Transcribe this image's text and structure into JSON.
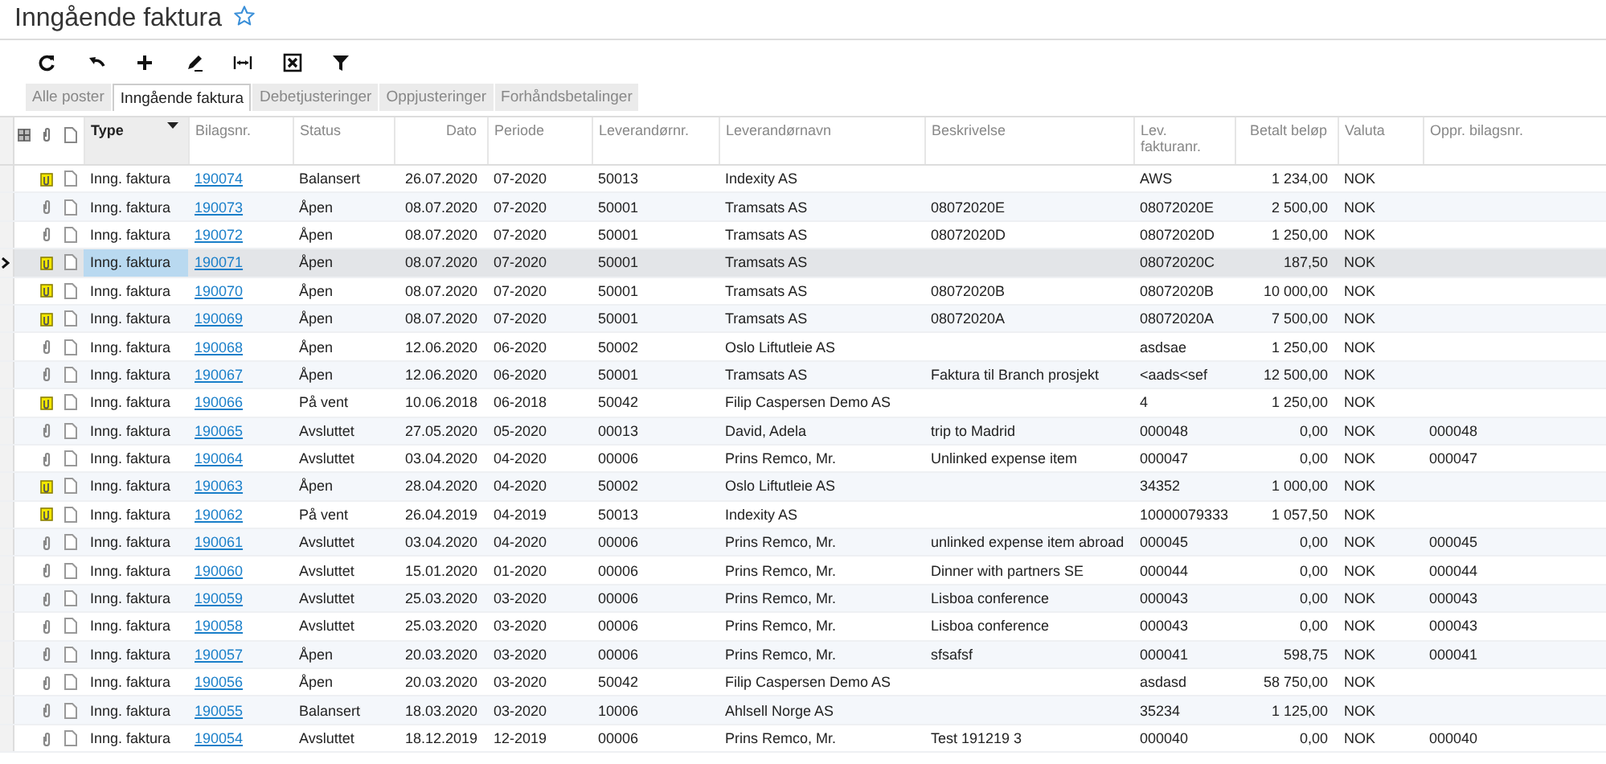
{
  "page": {
    "title": "Inngående faktura",
    "favorite": false
  },
  "toolbar": [
    {
      "kind": "refresh"
    },
    {
      "kind": "undo"
    },
    {
      "kind": "add"
    },
    {
      "kind": "edit"
    },
    {
      "kind": "fit"
    },
    {
      "kind": "excel"
    },
    {
      "kind": "filter"
    }
  ],
  "tabs": [
    {
      "label": "Alle poster",
      "selected": false
    },
    {
      "label": "Inngående faktura",
      "selected": true
    },
    {
      "label": "Debetjusteringer",
      "selected": false
    },
    {
      "label": "Oppjusteringer",
      "selected": false
    },
    {
      "label": "Forhåndsbetalinger",
      "selected": false
    }
  ],
  "table": {
    "columns": [
      {
        "label": "Type",
        "kind": "text",
        "sorted": true
      },
      {
        "label": "Bilagsnr.",
        "kind": "link",
        "sorted": false
      },
      {
        "label": "Status",
        "kind": "text",
        "sorted": false
      },
      {
        "label": "Dato",
        "kind": "number",
        "sorted": false
      },
      {
        "label": "Periode",
        "kind": "text",
        "sorted": false
      },
      {
        "label": "Leverandørnr.",
        "kind": "text",
        "sorted": false
      },
      {
        "label": "Leverandørnavn",
        "kind": "text",
        "sorted": false
      },
      {
        "label": "Beskrivelse",
        "kind": "text",
        "sorted": false
      },
      {
        "label": "Lev. fakturanr.",
        "kind": "text",
        "sorted": false
      },
      {
        "label": "Betalt beløp",
        "kind": "number",
        "sorted": false
      },
      {
        "label": "Valuta",
        "kind": "text",
        "sorted": false
      },
      {
        "label": "Oppr. bilagsnr.",
        "kind": "text",
        "sorted": false
      }
    ],
    "rows": [
      {
        "has_note": true,
        "selected": false,
        "cells": [
          "Inng. faktura",
          "190074",
          "Balansert",
          "26.07.2020",
          "07-2020",
          "50013",
          "Indexity AS",
          null,
          "AWS",
          "1 234,00",
          "NOK",
          null
        ]
      },
      {
        "has_note": false,
        "selected": false,
        "cells": [
          "Inng. faktura",
          "190073",
          "Åpen",
          "08.07.2020",
          "07-2020",
          "50001",
          "Tramsats AS",
          "08072020E",
          "08072020E",
          "2 500,00",
          "NOK",
          null
        ]
      },
      {
        "has_note": false,
        "selected": false,
        "cells": [
          "Inng. faktura",
          "190072",
          "Åpen",
          "08.07.2020",
          "07-2020",
          "50001",
          "Tramsats AS",
          "08072020D",
          "08072020D",
          "1 250,00",
          "NOK",
          null
        ]
      },
      {
        "has_note": true,
        "selected": true,
        "cells": [
          "Inng. faktura",
          "190071",
          "Åpen",
          "08.07.2020",
          "07-2020",
          "50001",
          "Tramsats AS",
          null,
          "08072020C",
          "187,50",
          "NOK",
          null
        ]
      },
      {
        "has_note": true,
        "selected": false,
        "cells": [
          "Inng. faktura",
          "190070",
          "Åpen",
          "08.07.2020",
          "07-2020",
          "50001",
          "Tramsats AS",
          "08072020B",
          "08072020B",
          "10 000,00",
          "NOK",
          null
        ]
      },
      {
        "has_note": true,
        "selected": false,
        "cells": [
          "Inng. faktura",
          "190069",
          "Åpen",
          "08.07.2020",
          "07-2020",
          "50001",
          "Tramsats AS",
          "08072020A",
          "08072020A",
          "7 500,00",
          "NOK",
          null
        ]
      },
      {
        "has_note": false,
        "selected": false,
        "cells": [
          "Inng. faktura",
          "190068",
          "Åpen",
          "12.06.2020",
          "06-2020",
          "50002",
          "Oslo Liftutleie AS",
          null,
          "asdsae",
          "1 250,00",
          "NOK",
          null
        ]
      },
      {
        "has_note": false,
        "selected": false,
        "cells": [
          "Inng. faktura",
          "190067",
          "Åpen",
          "12.06.2020",
          "06-2020",
          "50001",
          "Tramsats AS",
          "Faktura til Branch prosjekt",
          "<aads<sef",
          "12 500,00",
          "NOK",
          null
        ]
      },
      {
        "has_note": true,
        "selected": false,
        "cells": [
          "Inng. faktura",
          "190066",
          "På vent",
          "10.06.2018",
          "06-2018",
          "50042",
          "Filip Caspersen Demo AS",
          null,
          "4",
          "1 250,00",
          "NOK",
          null
        ]
      },
      {
        "has_note": false,
        "selected": false,
        "cells": [
          "Inng. faktura",
          "190065",
          "Avsluttet",
          "27.05.2020",
          "05-2020",
          "00013",
          "David, Adela",
          "trip to Madrid",
          "000048",
          "0,00",
          "NOK",
          "000048"
        ]
      },
      {
        "has_note": false,
        "selected": false,
        "cells": [
          "Inng. faktura",
          "190064",
          "Avsluttet",
          "03.04.2020",
          "04-2020",
          "00006",
          "Prins Remco, Mr.",
          "Unlinked expense item",
          "000047",
          "0,00",
          "NOK",
          "000047"
        ]
      },
      {
        "has_note": true,
        "selected": false,
        "cells": [
          "Inng. faktura",
          "190063",
          "Åpen",
          "28.04.2020",
          "04-2020",
          "50002",
          "Oslo Liftutleie AS",
          null,
          "34352",
          "1 000,00",
          "NOK",
          null
        ]
      },
      {
        "has_note": true,
        "selected": false,
        "cells": [
          "Inng. faktura",
          "190062",
          "På vent",
          "26.04.2019",
          "04-2019",
          "50013",
          "Indexity AS",
          null,
          "10000079333",
          "1 057,50",
          "NOK",
          null
        ]
      },
      {
        "has_note": false,
        "selected": false,
        "cells": [
          "Inng. faktura",
          "190061",
          "Avsluttet",
          "03.04.2020",
          "04-2020",
          "00006",
          "Prins Remco, Mr.",
          "unlinked expense item abroad",
          "000045",
          "0,00",
          "NOK",
          "000045"
        ]
      },
      {
        "has_note": false,
        "selected": false,
        "cells": [
          "Inng. faktura",
          "190060",
          "Avsluttet",
          "15.01.2020",
          "01-2020",
          "00006",
          "Prins Remco, Mr.",
          "Dinner with partners SE",
          "000044",
          "0,00",
          "NOK",
          "000044"
        ]
      },
      {
        "has_note": false,
        "selected": false,
        "cells": [
          "Inng. faktura",
          "190059",
          "Avsluttet",
          "25.03.2020",
          "03-2020",
          "00006",
          "Prins Remco, Mr.",
          "Lisboa conference",
          "000043",
          "0,00",
          "NOK",
          "000043"
        ]
      },
      {
        "has_note": false,
        "selected": false,
        "cells": [
          "Inng. faktura",
          "190058",
          "Avsluttet",
          "25.03.2020",
          "03-2020",
          "00006",
          "Prins Remco, Mr.",
          "Lisboa conference",
          "000043",
          "0,00",
          "NOK",
          "000043"
        ]
      },
      {
        "has_note": false,
        "selected": false,
        "cells": [
          "Inng. faktura",
          "190057",
          "Åpen",
          "20.03.2020",
          "03-2020",
          "00006",
          "Prins Remco, Mr.",
          "sfsafsf",
          "000041",
          "598,75",
          "NOK",
          "000041"
        ]
      },
      {
        "has_note": false,
        "selected": false,
        "cells": [
          "Inng. faktura",
          "190056",
          "Åpen",
          "20.03.2020",
          "03-2020",
          "50042",
          "Filip Caspersen Demo AS",
          null,
          "asdasd",
          "58 750,00",
          "NOK",
          null
        ]
      },
      {
        "has_note": false,
        "selected": false,
        "cells": [
          "Inng. faktura",
          "190055",
          "Balansert",
          "18.03.2020",
          "03-2020",
          "10006",
          "Ahlsell Norge AS",
          null,
          "35234",
          "1 125,00",
          "NOK",
          null
        ]
      },
      {
        "has_note": false,
        "selected": false,
        "cells": [
          "Inng. faktura",
          "190054",
          "Avsluttet",
          "18.12.2019",
          "12-2019",
          "00006",
          "Prins Remco, Mr.",
          "Test 191219 3",
          "000040",
          "0,00",
          "NOK",
          "000040"
        ]
      }
    ]
  }
}
